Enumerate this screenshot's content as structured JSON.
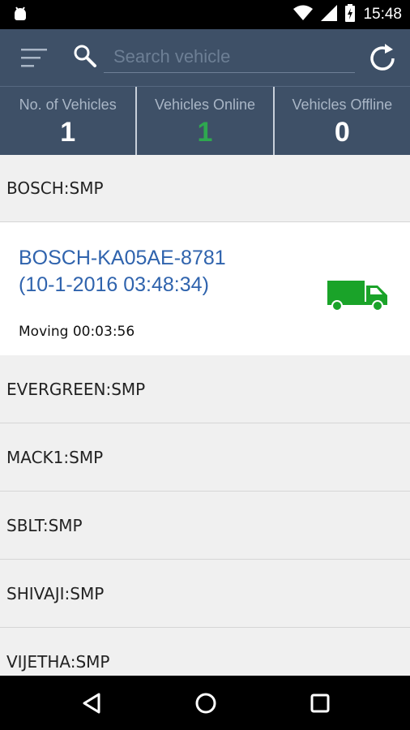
{
  "status_bar": {
    "time": "15:48"
  },
  "toolbar": {
    "search_placeholder": "Search vehicle"
  },
  "stats": [
    {
      "label": "No. of Vehicles",
      "value": "1"
    },
    {
      "label": "Vehicles Online",
      "value": "1"
    },
    {
      "label": "Vehicles Offline",
      "value": "0"
    }
  ],
  "groups": {
    "first": "BOSCH:SMP",
    "rest": [
      "EVERGREEN:SMP",
      "MACK1:SMP",
      "SBLT:SMP",
      "SHIVAJI:SMP",
      "VIJETHA:SMP"
    ]
  },
  "vehicle": {
    "line1": "BOSCH-KA05AE-8781",
    "line2": "(10-1-2016 03:48:34)",
    "status": "Moving 00:03:56",
    "icon": "truck-icon",
    "status_color": "#1aa329"
  },
  "colors": {
    "header": "#3e5067",
    "online": "#2ea84f",
    "link": "#2f63ad"
  }
}
